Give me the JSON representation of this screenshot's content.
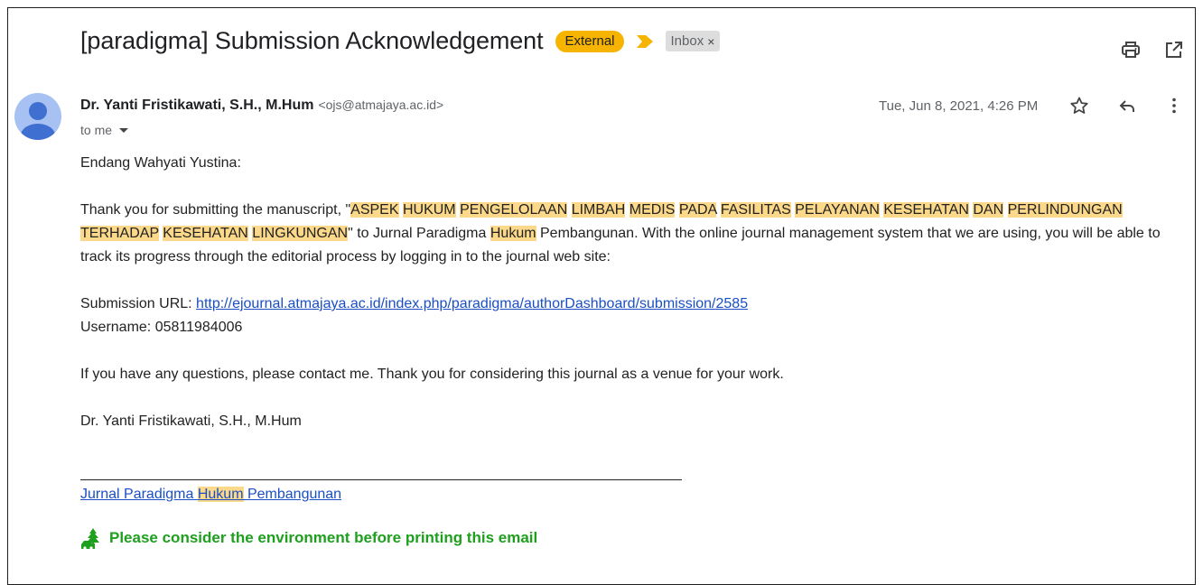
{
  "email": {
    "subject": "[paradigma] Submission Acknowledgement",
    "labels": {
      "external": "External",
      "inbox": "Inbox",
      "inbox_remove": "×"
    },
    "sender": {
      "name": "Dr. Yanti Fristikawati, S.H., M.Hum",
      "email": "<ojs@atmajaya.ac.id>"
    },
    "recipient": "to me",
    "date": "Tue, Jun 8, 2021, 4:26 PM",
    "icons": [
      "print-icon",
      "open-in-new-window-icon",
      "star-icon",
      "reply-icon",
      "more-vert-icon",
      "label-arrow-icon",
      "avatar-person-icon",
      "tree-car-icon"
    ],
    "colors": {
      "external_badge": "#f6b400",
      "highlight": "#fcd98a",
      "link": "#1a4fc4",
      "eco_green": "#1ea01e"
    }
  },
  "body": {
    "greeting": "Endang Wahyati Yustina:",
    "p1_prefix": "Thank you for submitting the manuscript, \"",
    "title_words": [
      "ASPEK",
      "HUKUM",
      "PENGELOLAAN",
      "LIMBAH",
      "MEDIS",
      "PADA",
      "FASILITAS",
      "PELAYANAN",
      "KESEHATAN",
      "DAN",
      "PERLINDUNGAN",
      "TERHADAP",
      "KESEHATAN",
      "LINGKUNGAN"
    ],
    "p1_mid": "\" to Jurnal Paradigma ",
    "p1_hukum": "Hukum",
    "p1_suffix": " Pembangunan. With the online journal management system that we are using, you will be able to track its progress through the editorial process by logging in to the journal web site:",
    "submission_label": "Submission URL: ",
    "submission_url": "http://ejournal.atmajaya.ac.id/index.php/paradigma/authorDashboard/submission/2585",
    "username_line": "Username: 05811984006",
    "questions": "If you have any questions, please contact me. Thank you for considering this journal as a venue for your work.",
    "signature": "Dr. Yanti Fristikawati, S.H., M.Hum"
  },
  "footer": {
    "link_part1": "Jurnal Paradigma ",
    "link_hukum": "Hukum",
    "link_part2": " Pembangunan",
    "eco_message": "Please consider the environment before printing this email"
  }
}
